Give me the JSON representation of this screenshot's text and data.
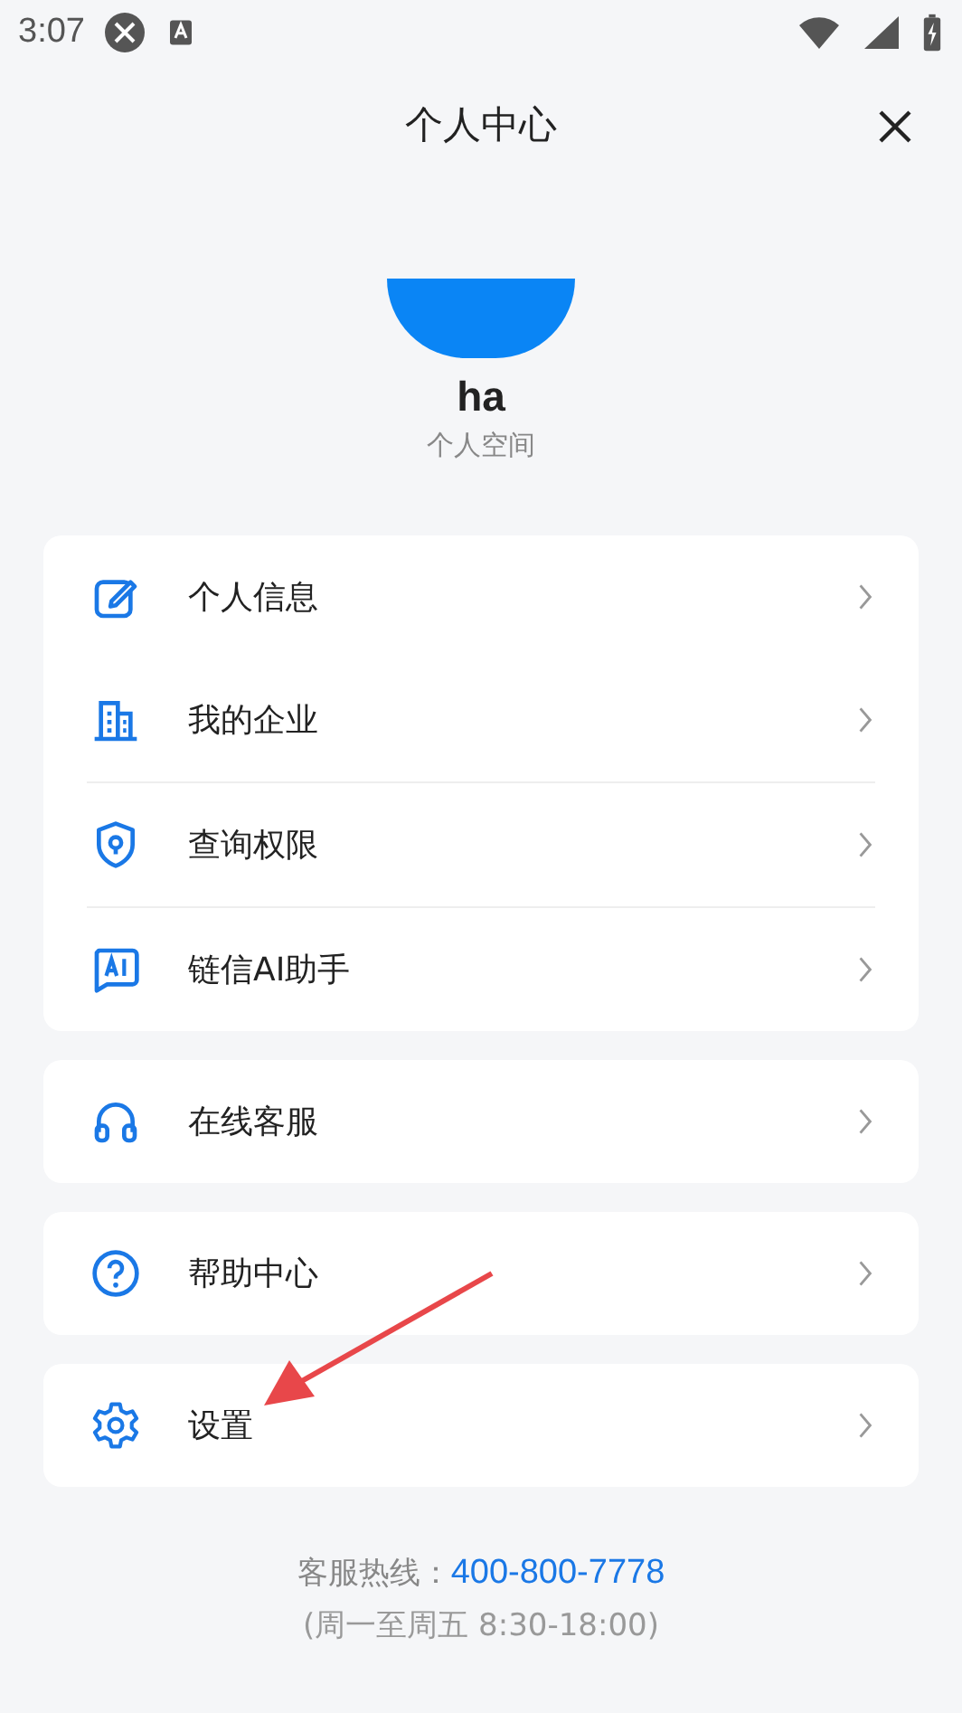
{
  "status_bar": {
    "time": "3:07"
  },
  "header": {
    "title": "个人中心"
  },
  "profile": {
    "name": "ha",
    "subtitle": "个人空间"
  },
  "groups": [
    {
      "items": [
        {
          "label": "个人信息",
          "divider_above": false
        },
        {
          "label": "我的企业",
          "divider_above": false
        },
        {
          "label": "查询权限",
          "divider_above": true
        },
        {
          "label": "链信AI助手",
          "divider_above": true
        }
      ]
    },
    {
      "items": [
        {
          "label": "在线客服",
          "divider_above": false
        }
      ]
    },
    {
      "items": [
        {
          "label": "帮助中心",
          "divider_above": false
        }
      ]
    },
    {
      "items": [
        {
          "label": "设置",
          "divider_above": false
        }
      ]
    }
  ],
  "footer": {
    "hotline_label": "客服热线：",
    "hotline_number": "400-800-7778",
    "hours": "(周一至周五 8:30-18:00)"
  },
  "annotations": [
    {
      "kind": "arrow"
    }
  ]
}
